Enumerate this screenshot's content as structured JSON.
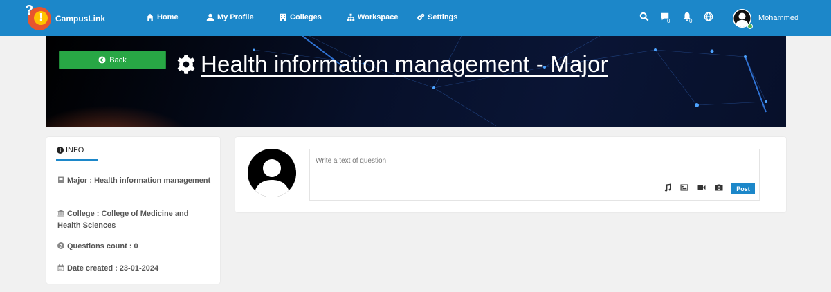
{
  "nav": {
    "brand": "CampusLink",
    "links": [
      {
        "label": "Home",
        "icon": "home-icon"
      },
      {
        "label": "My Profile",
        "icon": "user-icon"
      },
      {
        "label": "Colleges",
        "icon": "building-icon"
      },
      {
        "label": "Workspace",
        "icon": "sitemap-icon"
      },
      {
        "label": "Settings",
        "icon": "gears-icon"
      }
    ],
    "message_count": "0",
    "notification_count": "0",
    "username": "Mohammed",
    "accent": "#1c87c9"
  },
  "banner": {
    "back_label": "Back",
    "title": "Health information management - Major"
  },
  "info": {
    "heading": "INFO",
    "major": "Major : Health information management",
    "college": "College : College of Medicine and Health Sciences",
    "questions_count": "Questions count : 0",
    "date_created": "Date created : 23-01-2024"
  },
  "composer": {
    "placeholder": "Write a text of question",
    "post_label": "Post",
    "tools": [
      "music-icon",
      "image-icon",
      "video-icon",
      "camera-icon"
    ]
  }
}
